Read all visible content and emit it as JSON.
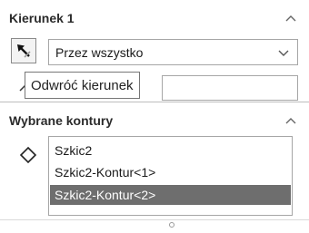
{
  "section_direction": {
    "title": "Kierunek 1",
    "dropdown_value": "Przez wszystko",
    "depth_value": ""
  },
  "tooltip": "Odwróć kierunek",
  "section_contours": {
    "title": "Wybrane kontury",
    "items": [
      "Szkic2",
      "Szkic2-Kontur<1>",
      "Szkic2-Kontur<2>"
    ],
    "selected_index": 2
  },
  "icons": {
    "collapse": "chevron-up-icon",
    "reverse_direction": "reverse-direction-arrow-icon",
    "dropdown": "chevron-down-icon",
    "contours": "diamond-contour-icon",
    "depth": "depth-arrow-icon"
  },
  "colors": {
    "selected_row_bg": "#6e6e6e",
    "selected_row_text": "#ffffff",
    "border": "#a6a6a6"
  }
}
